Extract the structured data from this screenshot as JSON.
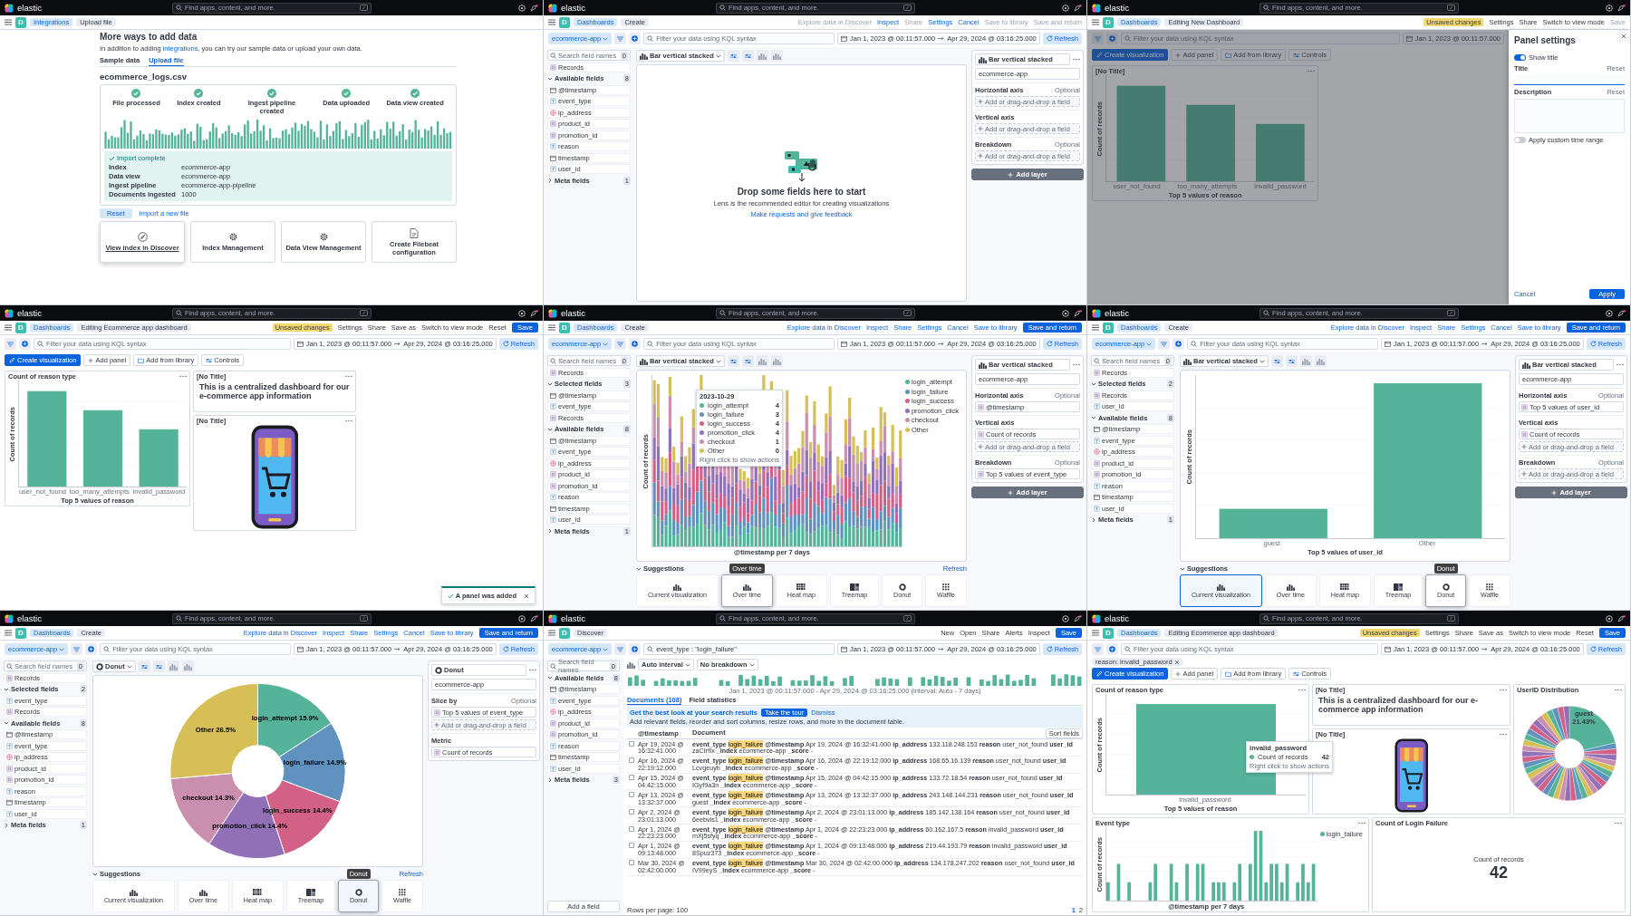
{
  "panels": [
    {
      "kind": "upload",
      "top": {
        "brand": "elastic",
        "search_placeholder": "Find apps, content, and more."
      },
      "space": "D",
      "breadcrumbs": [
        "Integrations",
        "Upload file"
      ],
      "heading": "More ways to add data",
      "intro": {
        "before": "In addition to adding ",
        "link": "integrations",
        "after": ", you can try our sample data or upload your own data."
      },
      "tabs": [
        {
          "label": "Sample data",
          "selected": false
        },
        {
          "label": "Upload file",
          "selected": true
        }
      ],
      "file_name": "ecommerce_logs.csv",
      "steps": [
        {
          "label": "File processed",
          "done": true
        },
        {
          "label": "Index created",
          "done": true
        },
        {
          "label": "Ingest pipeline created",
          "done": true
        },
        {
          "label": "Data uploaded",
          "done": true
        },
        {
          "label": "Data view created",
          "done": true
        }
      ],
      "import_title": "Import complete",
      "details": [
        {
          "label": "Index",
          "value": "ecommerce-app"
        },
        {
          "label": "Data view",
          "value": "ecommerce-app"
        },
        {
          "label": "Ingest pipeline",
          "value": "ecommerce-app-pipeline"
        },
        {
          "label": "Documents ingested",
          "value": "1000"
        }
      ],
      "reset": "Reset",
      "import_new": "Import a new file",
      "cards": [
        {
          "label": "View index in Discover",
          "kind": "discover",
          "hovered": true
        },
        {
          "label": "Index Management",
          "kind": "manage",
          "hovered": false
        },
        {
          "label": "Data View Management",
          "kind": "manage",
          "hovered": false
        },
        {
          "label": "Create Filebeat configuration",
          "kind": "config",
          "hovered": false
        }
      ]
    },
    {
      "kind": "lens",
      "top": {
        "brand": "elastic",
        "search_placeholder": "Find apps, content, and more."
      },
      "space": "D",
      "breadcrumbs": [
        "Dashboards",
        "Create"
      ],
      "actions": [
        {
          "label": "Explore data in Discover",
          "kind": "disabled"
        },
        {
          "label": "Inspect",
          "kind": "link"
        },
        {
          "label": "Share",
          "kind": "disabled"
        },
        {
          "label": "Settings",
          "kind": "link"
        },
        {
          "label": "Cancel",
          "kind": "link"
        },
        {
          "label": "Save to library",
          "kind": "disabled"
        },
        {
          "label": "Save and return",
          "kind": "disabled"
        }
      ],
      "filter": {
        "data_view": "ecommerce-app",
        "placeholder": "Filter your data using KQL syntax",
        "date_start": "Jan 1, 2023 @ 00:11:57.000",
        "date_end": "Apr 29, 2024 @ 03:16:25.000",
        "refresh": "Refresh"
      },
      "sidebar": {
        "search_placeholder": "Search field names",
        "count": "0",
        "records": "Records",
        "sections": [
          {
            "title": "Available fields",
            "count": "8",
            "expanded": true,
            "fields": [
              {
                "name": "@timestamp",
                "kind": "date"
              },
              {
                "name": "event_type",
                "kind": "keyword"
              },
              {
                "name": "ip_address",
                "kind": "ip"
              },
              {
                "name": "product_id",
                "kind": "number"
              },
              {
                "name": "promotion_id",
                "kind": "number"
              },
              {
                "name": "reason",
                "kind": "keyword"
              },
              {
                "name": "timestamp",
                "kind": "date"
              },
              {
                "name": "user_id",
                "kind": "keyword"
              }
            ]
          },
          {
            "title": "Meta fields",
            "count": "1",
            "expanded": false
          }
        ]
      },
      "chart_type": "Bar vertical stacked",
      "workspace": {
        "kind": "empty",
        "title": "Drop some fields here to start",
        "text": "Lens is the recommended editor for creating visualizations",
        "link": "Make requests and give feedback"
      },
      "config": {
        "layer_type": "Bar vertical stacked",
        "data_view": "ecommerce-app",
        "sections": [
          {
            "title": "Horizontal axis",
            "optional": "Optional",
            "items": [
              {
                "kind": "add",
                "label": "Add or drag-and-drop a field"
              }
            ]
          },
          {
            "title": "Vertical axis",
            "items": [
              {
                "kind": "add",
                "label": "Add or drag-and-drop a field"
              }
            ]
          },
          {
            "title": "Breakdown",
            "optional": "Optional",
            "items": [
              {
                "kind": "add",
                "label": "Add or drag-and-drop a field"
              }
            ]
          }
        ],
        "add_layer": "Add layer"
      }
    },
    {
      "kind": "dashboard",
      "top": {
        "brand": "elastic",
        "search_placeholder": "Find apps, content, and more."
      },
      "space": "D",
      "breadcrumbs": [
        "Dashboards",
        "Editing New Dashboard"
      ],
      "actions": [
        {
          "label": "Unsaved changes",
          "kind": "badge"
        },
        {
          "label": "Settings",
          "kind": "plain"
        },
        {
          "label": "Share",
          "kind": "plain"
        },
        {
          "label": "Switch to view mode",
          "kind": "plain"
        },
        {
          "label": "Save",
          "kind": "disabled"
        }
      ],
      "filter": {
        "placeholder": "Filter your data using KQL syntax",
        "date_start": "Jan 1, 2023 @ 00:11:57.000"
      },
      "toolbar": {
        "create": "Create visualization",
        "add_panel": "Add panel",
        "add_library": "Add from library",
        "controls": "Controls"
      },
      "tiles": [
        {
          "kind": "bar",
          "title": "[No Title]",
          "categories": [
            "user_not_found",
            "too_many_attempts",
            "invalid_password"
          ],
          "xlabel": "Top 5 values of reason",
          "ylabel": "Count of records"
        }
      ],
      "flyout": {
        "title": "Panel settings",
        "show_title": {
          "label": "Show title",
          "on": true
        },
        "title_label": "Title",
        "title_reset": "Reset",
        "description_label": "Description",
        "description_reset": "Reset",
        "time_range": {
          "label": "Apply custom time range",
          "on": false
        },
        "cancel": "Cancel",
        "apply": "Apply"
      }
    },
    {
      "kind": "dashboard",
      "top": {
        "brand": "elastic",
        "search_placeholder": "Find apps, content, and more."
      },
      "space": "D",
      "breadcrumbs": [
        "Dashboards",
        "Editing Ecommerce app dashboard"
      ],
      "actions": [
        {
          "label": "Unsaved changes",
          "kind": "badge"
        },
        {
          "label": "Settings",
          "kind": "plain"
        },
        {
          "label": "Share",
          "kind": "plain"
        },
        {
          "label": "Save as",
          "kind": "plain"
        },
        {
          "label": "Switch to view mode",
          "kind": "plain"
        },
        {
          "label": "Reset",
          "kind": "plain"
        },
        {
          "label": "Save",
          "kind": "primary"
        }
      ],
      "filter": {
        "placeholder": "Filter your data using KQL syntax",
        "date_start": "Jan 1, 2023 @ 00:11:57.000",
        "date_end": "Apr 29, 2024 @ 03:16:25.000",
        "refresh": "Refresh"
      },
      "toolbar": {
        "create": "Create visualization",
        "add_panel": "Add panel",
        "add_library": "Add from library",
        "controls": "Controls"
      },
      "tiles": [
        {
          "kind": "bar",
          "title": "Count of reason type",
          "categories": [
            "user_not_found",
            "too_many_attempts",
            "invalid_password"
          ],
          "xlabel": "Top 5 values of reason",
          "ylabel": "Count of records"
        },
        {
          "kind": "markdown",
          "title": "[No Title]",
          "text": "This is a centralized dashboard for our e-commerce app information"
        },
        {
          "kind": "image",
          "title": "[No Title]"
        }
      ],
      "toast": "A panel was added"
    },
    {
      "kind": "lens",
      "top": {
        "brand": "elastic",
        "search_placeholder": "Find apps, content, and more."
      },
      "space": "D",
      "breadcrumbs": [
        "Dashboards",
        "Create"
      ],
      "actions": [
        {
          "label": "Explore data in Discover",
          "kind": "link"
        },
        {
          "label": "Inspect",
          "kind": "link"
        },
        {
          "label": "Share",
          "kind": "link"
        },
        {
          "label": "Settings",
          "kind": "link"
        },
        {
          "label": "Cancel",
          "kind": "link"
        },
        {
          "label": "Save to library",
          "kind": "link"
        },
        {
          "label": "Save and return",
          "kind": "primary"
        }
      ],
      "filter": {
        "data_view": "ecommerce-app",
        "placeholder": "Filter your data using KQL syntax",
        "date_start": "Jan 1, 2023 @ 00:11:57.000",
        "date_end": "Apr 29, 2024 @ 03:16:25.000",
        "refresh": "Refresh"
      },
      "sidebar": {
        "search_placeholder": "Search field names",
        "count": "0",
        "records": "Records",
        "sections": [
          {
            "title": "Selected fields",
            "count": "3",
            "expanded": true,
            "fields": [
              {
                "name": "@timestamp",
                "kind": "date"
              },
              {
                "name": "event_type",
                "kind": "keyword"
              },
              {
                "name": "Records",
                "kind": "number"
              }
            ]
          },
          {
            "title": "Available fields",
            "count": "8",
            "expanded": true,
            "fields": [
              {
                "name": "@timestamp",
                "kind": "date"
              },
              {
                "name": "event_type",
                "kind": "keyword"
              },
              {
                "name": "ip_address",
                "kind": "ip"
              },
              {
                "name": "product_id",
                "kind": "number"
              },
              {
                "name": "promotion_id",
                "kind": "number"
              },
              {
                "name": "reason",
                "kind": "keyword"
              },
              {
                "name": "timestamp",
                "kind": "date"
              },
              {
                "name": "user_id",
                "kind": "keyword"
              }
            ]
          },
          {
            "title": "Meta fields",
            "count": "1",
            "expanded": false
          }
        ]
      },
      "chart_type": "Bar vertical stacked",
      "workspace": {
        "kind": "stacked",
        "ylabel": "Count of records",
        "xlabel": "@timestamp per 7 days",
        "legend": [
          {
            "label": "login_attempt",
            "color": "#54b399"
          },
          {
            "label": "login_failure",
            "color": "#6092c0"
          },
          {
            "label": "login_success",
            "color": "#d36086"
          },
          {
            "label": "promotion_click",
            "color": "#9170b8"
          },
          {
            "label": "checkout",
            "color": "#ca8eae"
          },
          {
            "label": "Other",
            "color": "#d6bf57"
          }
        ],
        "tooltip": {
          "title": "2023-10-29",
          "rows": [
            {
              "label": "login_attempt",
              "value": "4",
              "color": "#54b399"
            },
            {
              "label": "login_failure",
              "value": "3",
              "color": "#6092c0"
            },
            {
              "label": "login_success",
              "value": "4",
              "color": "#d36086"
            },
            {
              "label": "promotion_click",
              "value": "4",
              "color": "#9170b8"
            },
            {
              "label": "checkout",
              "value": "1",
              "color": "#ca8eae"
            },
            {
              "label": "Other",
              "value": "0",
              "color": "#d6bf57"
            }
          ],
          "hint": "Right click to show actions"
        }
      },
      "config": {
        "layer_type": "Bar vertical stacked",
        "data_view": "ecommerce-app",
        "sections": [
          {
            "title": "Horizontal axis",
            "optional": "Optional",
            "items": [
              {
                "kind": "field",
                "label": "@timestamp"
              }
            ]
          },
          {
            "title": "Vertical axis",
            "items": [
              {
                "kind": "field",
                "label": "Count of records"
              },
              {
                "kind": "add",
                "label": "Add or drag-and-drop a field"
              }
            ]
          },
          {
            "title": "Breakdown",
            "optional": "Optional",
            "items": [
              {
                "kind": "field",
                "label": "Top 5 values of event_type"
              }
            ]
          }
        ],
        "add_layer": "Add layer"
      },
      "suggestions": {
        "title": "Suggestions",
        "refresh": "Refresh",
        "tooltip": "Over time",
        "items": [
          {
            "label": "Current visualization",
            "kind": "bar",
            "selected": false,
            "hovered": false
          },
          {
            "label": "Over time",
            "kind": "bar",
            "selected": false,
            "hovered": true
          },
          {
            "label": "Heat map",
            "kind": "heatmap",
            "selected": false,
            "hovered": false
          },
          {
            "label": "Treemap",
            "kind": "treemap",
            "selected": false,
            "hovered": false
          },
          {
            "label": "Donut",
            "kind": "donut",
            "selected": false,
            "hovered": false
          },
          {
            "label": "Waffle",
            "kind": "waffle",
            "selected": false,
            "hovered": false
          }
        ]
      }
    },
    {
      "kind": "lens",
      "top": {
        "brand": "elastic",
        "search_placeholder": "Find apps, content, and more."
      },
      "space": "D",
      "breadcrumbs": [
        "Dashboards",
        "Create"
      ],
      "actions": [
        {
          "label": "Explore data in Discover",
          "kind": "link"
        },
        {
          "label": "Inspect",
          "kind": "link"
        },
        {
          "label": "Share",
          "kind": "link"
        },
        {
          "label": "Settings",
          "kind": "link"
        },
        {
          "label": "Cancel",
          "kind": "link"
        },
        {
          "label": "Save to library",
          "kind": "link"
        },
        {
          "label": "Save and return",
          "kind": "primary"
        }
      ],
      "filter": {
        "data_view": "ecommerce-app",
        "placeholder": "Filter your data using KQL syntax",
        "date_start": "Jan 1, 2023 @ 00:11:57.000",
        "date_end": "Apr 29, 2024 @ 03:16:25.000",
        "refresh": "Refresh"
      },
      "sidebar": {
        "search_placeholder": "Search field names",
        "count": "0",
        "records": "Records",
        "sections": [
          {
            "title": "Selected fields",
            "count": "2",
            "expanded": true,
            "fields": [
              {
                "name": "Records",
                "kind": "number"
              },
              {
                "name": "user_id",
                "kind": "keyword"
              }
            ]
          },
          {
            "title": "Available fields",
            "count": "8",
            "expanded": true,
            "fields": [
              {
                "name": "@timestamp",
                "kind": "date"
              },
              {
                "name": "event_type",
                "kind": "keyword"
              },
              {
                "name": "ip_address",
                "kind": "ip"
              },
              {
                "name": "product_id",
                "kind": "number"
              },
              {
                "name": "promotion_id",
                "kind": "number"
              },
              {
                "name": "reason",
                "kind": "keyword"
              },
              {
                "name": "timestamp",
                "kind": "date"
              },
              {
                "name": "user_id",
                "kind": "keyword"
              }
            ]
          },
          {
            "title": "Meta fields",
            "count": "1",
            "expanded": false
          }
        ]
      },
      "chart_type": "Bar vertical stacked",
      "workspace": {
        "kind": "bars",
        "ylabel": "Count of records",
        "xlabel": "Top 5 values of user_id",
        "categories": [
          "guest",
          "Other"
        ]
      },
      "config": {
        "layer_type": "Bar vertical stacked",
        "data_view": "ecommerce-app",
        "sections": [
          {
            "title": "Horizontal axis",
            "optional": "Optional",
            "items": [
              {
                "kind": "field",
                "label": "Top 5 values of user_id"
              }
            ]
          },
          {
            "title": "Vertical axis",
            "items": [
              {
                "kind": "field",
                "label": "Count of records"
              },
              {
                "kind": "add",
                "label": "Add or drag-and-drop a field"
              }
            ]
          },
          {
            "title": "Breakdown",
            "optional": "Optional",
            "items": [
              {
                "kind": "add",
                "label": "Add or drag-and-drop a field"
              }
            ]
          }
        ],
        "add_layer": "Add layer"
      },
      "suggestions": {
        "title": "Suggestions",
        "tooltip": "Donut",
        "items": [
          {
            "label": "Current visualization",
            "kind": "bar",
            "selected": true,
            "hovered": false
          },
          {
            "label": "Over time",
            "kind": "bar",
            "selected": false,
            "hovered": false
          },
          {
            "label": "Heat map",
            "kind": "heatmap",
            "selected": false,
            "hovered": false
          },
          {
            "label": "Treemap",
            "kind": "treemap",
            "selected": false,
            "hovered": false
          },
          {
            "label": "Donut",
            "kind": "donut",
            "selected": false,
            "hovered": true
          },
          {
            "label": "Waffle",
            "kind": "waffle",
            "selected": false,
            "hovered": false
          }
        ]
      }
    },
    {
      "kind": "lens",
      "top": {
        "brand": "elastic",
        "search_placeholder": "Find apps, content, and more."
      },
      "space": "D",
      "breadcrumbs": [
        "Dashboards",
        "Create"
      ],
      "actions": [
        {
          "label": "Explore data in Discover",
          "kind": "link"
        },
        {
          "label": "Inspect",
          "kind": "link"
        },
        {
          "label": "Share",
          "kind": "link"
        },
        {
          "label": "Settings",
          "kind": "link"
        },
        {
          "label": "Cancel",
          "kind": "link"
        },
        {
          "label": "Save to library",
          "kind": "link"
        },
        {
          "label": "Save and return",
          "kind": "primary"
        }
      ],
      "filter": {
        "data_view": "ecommerce-app",
        "placeholder": "Filter your data using KQL syntax",
        "date_start": "Jan 1, 2023 @ 00:11:57.000",
        "date_end": "Apr 29, 2024 @ 03:16:25.000",
        "refresh": "Refresh"
      },
      "sidebar": {
        "search_placeholder": "Search field names",
        "count": "0",
        "records": "Records",
        "sections": [
          {
            "title": "Selected fields",
            "count": "2",
            "expanded": true,
            "fields": [
              {
                "name": "event_type",
                "kind": "keyword"
              },
              {
                "name": "Records",
                "kind": "number"
              }
            ]
          },
          {
            "title": "Available fields",
            "count": "8",
            "expanded": true,
            "fields": [
              {
                "name": "@timestamp",
                "kind": "date"
              },
              {
                "name": "event_type",
                "kind": "keyword"
              },
              {
                "name": "ip_address",
                "kind": "ip"
              },
              {
                "name": "product_id",
                "kind": "number"
              },
              {
                "name": "promotion_id",
                "kind": "number"
              },
              {
                "name": "reason",
                "kind": "keyword"
              },
              {
                "name": "timestamp",
                "kind": "date"
              },
              {
                "name": "user_id",
                "kind": "keyword"
              }
            ]
          },
          {
            "title": "Meta fields",
            "count": "1",
            "expanded": false
          }
        ]
      },
      "chart_type": "Donut",
      "workspace": {
        "kind": "donut",
        "chart_data": {
          "type": "donut",
          "categories": [
            "login_attempt",
            "login_failure",
            "login_success",
            "promotion_click",
            "checkout",
            "Other"
          ],
          "values": [
            15.9,
            14.9,
            14.4,
            14.4,
            14.3,
            26.5
          ],
          "value_labels": [
            "15.9%",
            "14.9%",
            "14.4%",
            "14.4%",
            "14.3%",
            "26.5%"
          ]
        }
      },
      "config": {
        "layer_type": "Donut",
        "data_view": "ecommerce-app",
        "sections": [
          {
            "title": "Slice by",
            "optional": "Optional",
            "items": [
              {
                "kind": "field",
                "label": "Top 5 values of event_type"
              },
              {
                "kind": "add",
                "label": "Add or drag-and-drop a field"
              }
            ]
          },
          {
            "title": "Metric",
            "items": [
              {
                "kind": "field",
                "label": "Count of records"
              }
            ]
          }
        ]
      },
      "suggestions": {
        "title": "Suggestions",
        "refresh": "Refresh",
        "tooltip": "Donut",
        "items": [
          {
            "label": "Current visualization",
            "kind": "bar",
            "selected": false,
            "hovered": false
          },
          {
            "label": "Over time",
            "kind": "bar",
            "selected": false,
            "hovered": false
          },
          {
            "label": "Heat map",
            "kind": "heatmap",
            "selected": false,
            "hovered": false
          },
          {
            "label": "Treemap",
            "kind": "treemap",
            "selected": false,
            "hovered": false
          },
          {
            "label": "Donut",
            "kind": "donut",
            "selected": true,
            "hovered": true
          },
          {
            "label": "Waffle",
            "kind": "waffle",
            "selected": false,
            "hovered": false
          }
        ]
      }
    },
    {
      "kind": "discover",
      "top": {
        "brand": "elastic",
        "search_placeholder": "Find apps, content, and more."
      },
      "space": "D",
      "breadcrumbs": [
        "Discover"
      ],
      "actions": [
        {
          "label": "New",
          "kind": "plain"
        },
        {
          "label": "Open",
          "kind": "plain"
        },
        {
          "label": "Share",
          "kind": "plain"
        },
        {
          "label": "Alerts",
          "kind": "plain"
        },
        {
          "label": "Inspect",
          "kind": "plain"
        },
        {
          "label": "Save",
          "kind": "primary"
        }
      ],
      "filter": {
        "data_view": "ecommerce-app",
        "query": "event_type : \"login_failure\"",
        "date_start": "Jan 1, 2023 @ 00:11:57.000",
        "date_end": "Apr 29, 2024 @ 03:16:25.000",
        "refresh": "Refresh"
      },
      "sidebar": {
        "search_placeholder": "Search field names",
        "count": "0",
        "sections": [
          {
            "title": "Available fields",
            "count": "8",
            "expanded": true,
            "fields": [
              {
                "name": "@timestamp",
                "kind": "date"
              },
              {
                "name": "event_type",
                "kind": "keyword"
              },
              {
                "name": "ip_address",
                "kind": "ip"
              },
              {
                "name": "product_id",
                "kind": "number"
              },
              {
                "name": "promotion_id",
                "kind": "number"
              },
              {
                "name": "reason",
                "kind": "keyword"
              },
              {
                "name": "timestamp",
                "kind": "date"
              },
              {
                "name": "user_id",
                "kind": "keyword"
              }
            ]
          },
          {
            "title": "Meta fields",
            "count": "3",
            "expanded": false
          }
        ],
        "add_field": "Add a field"
      },
      "interval": "Auto interval",
      "breakdown": "No breakdown",
      "range_text": "Jan 1, 2023 @ 00:11:57.000 - Apr 29, 2024 @ 03:16:25.000 (interval: Auto - 7 days)",
      "tabs": [
        {
          "label": "Documents (108)",
          "selected": true
        },
        {
          "label": "Field statistics",
          "selected": false
        }
      ],
      "callout": {
        "title": "Get the best look at your search results",
        "text": "Add relevant fields, reorder and sort columns, resize rows, and more in the document table.",
        "tour": "Take the tour",
        "dismiss": "Dismiss"
      },
      "sort_fields": "Sort fields",
      "columns": [
        "@timestamp",
        "Document"
      ],
      "rows": [
        {
          "checked": false,
          "timestamp": "Apr 19, 2024 @ 16:32:41.000",
          "key": "event_type",
          "match": "login_failure",
          "rest": "**@timestamp** Apr 19, 2024 @ 16:32:41.000 **ip_address** 133.118.248.153 **reason** user_not_found **user_id** zaCIrfIx **_index** ecommerce-app **_score** -"
        },
        {
          "checked": false,
          "timestamp": "Apr 16, 2024 @ 22:19:12.000",
          "key": "event_type",
          "match": "login_failure",
          "rest": "**@timestamp** Apr 16, 2024 @ 22:19:12.000 **ip_address** 168.65.16.139 **reason** user_not_found **user_id** Lcvgeuyb **_index** ecommerce-app **_score** -"
        },
        {
          "checked": false,
          "timestamp": "Apr 15, 2024 @ 04:42:15.000",
          "key": "event_type",
          "match": "login_failure",
          "rest": "**@timestamp** Apr 15, 2024 @ 04:42:15.000 **ip_address** 133.72.18.54 **reason** user_not_found **user_id** IGyf9a3n **_index** ecommerce-app **_score** -"
        },
        {
          "checked": false,
          "timestamp": "Apr 13, 2024 @ 13:32:37.000",
          "key": "event_type",
          "match": "login_failure",
          "rest": "**@timestamp** Apr 13, 2024 @ 13:32:37.000 **ip_address** 243.148.144.231 **reason** user_not_found **user_id** guest **_index** ecommerce-app **_score** -"
        },
        {
          "checked": false,
          "timestamp": "Apr 2, 2024 @ 23:01:13.000",
          "key": "event_type",
          "match": "login_failure",
          "rest": "**@timestamp** Apr 2, 2024 @ 23:01:13.000 **ip_address** 185.142.138.164 **reason** user_not_found **user_id** 6eebvls1 **_index** ecommerce-app **_score** -"
        },
        {
          "checked": false,
          "timestamp": "Apr 1, 2024 @ 22:23:23.000",
          "key": "event_type",
          "match": "login_failure",
          "rest": "**@timestamp** Apr 1, 2024 @ 22:23:23.000 **ip_address** 60.162.167.5 **reason** invalid_password **user_id** mXj5sfyq **_index** ecommerce-app **_score** -"
        },
        {
          "checked": false,
          "timestamp": "Apr 1, 2024 @ 09:13:48.000",
          "key": "event_type",
          "match": "login_failure",
          "rest": "**@timestamp** Apr 1, 2024 @ 09:13:48.000 **ip_address** 219.44.193.79 **reason** invalid_password **user_id** 8Spuz373 **_index** ecommerce-app **_score** -"
        },
        {
          "checked": false,
          "timestamp": "Mar 30, 2024 @ 02:42:00.000",
          "key": "event_type",
          "match": "login_failure",
          "rest": "**@timestamp** Mar 30, 2024 @ 02:42:00.000 **ip_address** 134.178.247.202 **reason** user_not_found **user_id** IV99eyS **_index** ecommerce-app **_score** -"
        }
      ],
      "rows_per_page": "Rows per page: 100",
      "pages": [
        {
          "label": "1",
          "selected": true
        },
        {
          "label": "2",
          "selected": false
        }
      ]
    },
    {
      "kind": "dashboard",
      "top": {
        "brand": "elastic",
        "search_placeholder": "Find apps, content, and more."
      },
      "space": "D",
      "breadcrumbs": [
        "Dashboards",
        "Editing Ecommerce app dashboard"
      ],
      "actions": [
        {
          "label": "Unsaved changes",
          "kind": "badge"
        },
        {
          "label": "Settings",
          "kind": "plain"
        },
        {
          "label": "Share",
          "kind": "plain"
        },
        {
          "label": "Save as",
          "kind": "plain"
        },
        {
          "label": "Switch to view mode",
          "kind": "plain"
        },
        {
          "label": "Reset",
          "kind": "plain"
        },
        {
          "label": "Save",
          "kind": "primary"
        }
      ],
      "filter": {
        "placeholder": "Filter your data using KQL syntax",
        "date_start": "Jan 1, 2023 @ 00:11:57.000",
        "date_end": "Apr 29, 2024 @ 03:16:25.000",
        "refresh": "Refresh"
      },
      "pills": [
        "reason: invalid_password"
      ],
      "toolbar": {
        "create": "Create visualization",
        "add_panel": "Add panel",
        "add_library": "Add from library",
        "controls": "Controls"
      },
      "tiles": [
        {
          "kind": "bar",
          "title": "Count of reason type",
          "categories": [
            "invalid_password"
          ],
          "xlabel": "Top 5 values of reason",
          "ylabel": "Count of records",
          "tooltip": {
            "title": "invalid_password",
            "rows": [
              {
                "label": "Count of records",
                "value": "42",
                "color": "#54b399"
              }
            ],
            "hint": "Right click to show actions"
          }
        },
        {
          "kind": "markdown",
          "title": "[No Title]",
          "text": "This is a centralized dashboard for our e-commerce app information"
        },
        {
          "kind": "donut",
          "title": "UserID Distribution",
          "label": "guest 21.43%"
        },
        {
          "kind": "image",
          "title": "[No Title]"
        },
        {
          "kind": "timebars",
          "title": "Event type",
          "legend": [
            {
              "label": "login_failure",
              "color": "#54b399"
            }
          ],
          "xlabel": "@timestamp per 7 days",
          "ylabel": "Count of records"
        },
        {
          "kind": "metric",
          "title": "Count of Login Failure",
          "label": "Count of records",
          "value": "42"
        }
      ]
    }
  ]
}
